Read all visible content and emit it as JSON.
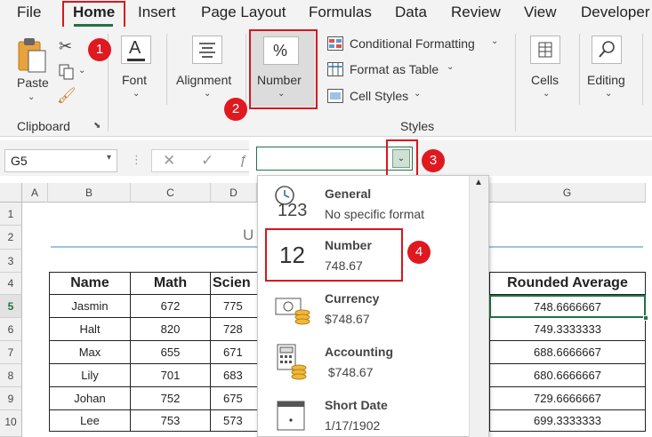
{
  "menu": {
    "tabs": [
      "File",
      "Home",
      "Insert",
      "Page Layout",
      "Formulas",
      "Data",
      "Review",
      "View",
      "Developer"
    ]
  },
  "ribbon": {
    "paste": "Paste",
    "clipboard": "Clipboard",
    "font": "Font",
    "alignment": "Alignment",
    "number": "Number",
    "conditional_formatting": "Conditional Formatting",
    "format_as_table": "Format as Table",
    "cell_styles": "Cell Styles",
    "styles": "Styles",
    "cells": "Cells",
    "editing": "Editing",
    "number_icon": "%"
  },
  "formula_bar": {
    "name_box": "G5",
    "fx": "ƒ"
  },
  "badges": [
    "1",
    "2",
    "3",
    "4"
  ],
  "grid": {
    "columns": [
      "A",
      "B",
      "C",
      "D",
      "G"
    ],
    "rows": [
      "1",
      "2",
      "3",
      "4",
      "5",
      "6",
      "7",
      "8",
      "9",
      "10"
    ],
    "title_fragment": "U",
    "headers": [
      "Name",
      "Math",
      "Scien",
      "Rounded Average"
    ],
    "data": [
      {
        "name": "Jasmin",
        "math": "672",
        "sci": "775",
        "avg": "748.6666667"
      },
      {
        "name": "Halt",
        "math": "820",
        "sci": "728",
        "avg": "749.3333333"
      },
      {
        "name": "Max",
        "math": "655",
        "sci": "671",
        "avg": "688.6666667"
      },
      {
        "name": "Lily",
        "math": "701",
        "sci": "683",
        "avg": "680.6666667"
      },
      {
        "name": "Johan",
        "math": "752",
        "sci": "675",
        "avg": "729.6666667"
      },
      {
        "name": "Lee",
        "math": "753",
        "sci": "573",
        "avg": "699.3333333"
      }
    ]
  },
  "dropdown": {
    "items": [
      {
        "name": "General",
        "sample": "No specific format",
        "icon": "123"
      },
      {
        "name": "Number",
        "sample": "748.67",
        "icon": "12"
      },
      {
        "name": "Currency",
        "sample": "$748.67"
      },
      {
        "name": "Accounting",
        "sample": " $748.67"
      },
      {
        "name": "Short Date",
        "sample": "1/17/1902"
      }
    ]
  },
  "colors": {
    "accent": "#217346",
    "highlight": "#d9161d"
  }
}
